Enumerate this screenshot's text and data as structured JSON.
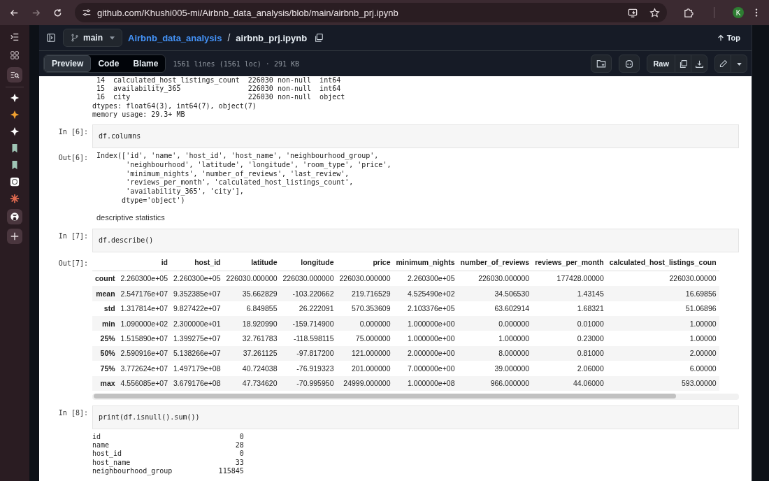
{
  "browser": {
    "url": "github.com/Khushi005-mi/Airbnb_data_analysis/blob/main/airbnb_prj.ipynb",
    "profile_initial": "K"
  },
  "repo": {
    "branch": "main",
    "repo_name": "Airbnb_data_analysis",
    "separator": "/",
    "file_name": "airbnb_prj.ipynb",
    "top_label": "Top"
  },
  "file_toolbar": {
    "views": [
      {
        "label": "Preview",
        "selected": true
      },
      {
        "label": "Code",
        "selected": false
      },
      {
        "label": "Blame",
        "selected": false
      }
    ],
    "info": "1561 lines (1561 loc) · 291 KB",
    "raw_label": "Raw"
  },
  "cells": [
    {
      "kind": "output",
      "lines": [
        " 14  calculated_host_listings_count  226030 non-null  int64",
        " 15  availability_365                226030 non-null  int64",
        " 16  city                            226030 non-null  object",
        "dtypes: float64(3), int64(7), object(7)",
        "memory usage: 29.3+ MB"
      ]
    },
    {
      "kind": "code",
      "prompt": "In [6]:",
      "code": "df.columns"
    },
    {
      "kind": "output",
      "prompt": "Out[6]:",
      "lines": [
        "Index(['id', 'name', 'host_id', 'host_name', 'neighbourhood_group',",
        "       'neighbourhood', 'latitude', 'longitude', 'room_type', 'price',",
        "       'minimum_nights', 'number_of_reviews', 'last_review',",
        "       'reviews_per_month', 'calculated_host_listings_count',",
        "       'availability_365', 'city'],",
        "      dtype='object')"
      ]
    },
    {
      "kind": "markdown",
      "text": "descriptive statistics"
    },
    {
      "kind": "code",
      "prompt": "In [7]:",
      "code": "df.describe()"
    },
    {
      "kind": "dataframe",
      "prompt": "Out[7]:",
      "columns": [
        "id",
        "host_id",
        "latitude",
        "longitude",
        "price",
        "minimum_nights",
        "number_of_reviews",
        "reviews_per_month",
        "calculated_host_listings_coun"
      ],
      "rows": [
        {
          "label": "count",
          "values": [
            "2.260300e+05",
            "2.260300e+05",
            "226030.000000",
            "226030.000000",
            "226030.000000",
            "2.260300e+05",
            "226030.000000",
            "177428.00000",
            "226030.00000"
          ]
        },
        {
          "label": "mean",
          "values": [
            "2.547176e+07",
            "9.352385e+07",
            "35.662829",
            "-103.220662",
            "219.716529",
            "4.525490e+02",
            "34.506530",
            "1.43145",
            "16.69856"
          ]
        },
        {
          "label": "std",
          "values": [
            "1.317814e+07",
            "9.827422e+07",
            "6.849855",
            "26.222091",
            "570.353609",
            "2.103376e+05",
            "63.602914",
            "1.68321",
            "51.06896"
          ]
        },
        {
          "label": "min",
          "values": [
            "1.090000e+02",
            "2.300000e+01",
            "18.920990",
            "-159.714900",
            "0.000000",
            "1.000000e+00",
            "0.000000",
            "0.01000",
            "1.00000"
          ]
        },
        {
          "label": "25%",
          "values": [
            "1.515890e+07",
            "1.399275e+07",
            "32.761783",
            "-118.598115",
            "75.000000",
            "1.000000e+00",
            "1.000000",
            "0.23000",
            "1.00000"
          ]
        },
        {
          "label": "50%",
          "values": [
            "2.590916e+07",
            "5.138266e+07",
            "37.261125",
            "-97.817200",
            "121.000000",
            "2.000000e+00",
            "8.000000",
            "0.81000",
            "2.00000"
          ]
        },
        {
          "label": "75%",
          "values": [
            "3.772624e+07",
            "1.497179e+08",
            "40.724038",
            "-76.919323",
            "201.000000",
            "7.000000e+00",
            "39.000000",
            "2.06000",
            "6.00000"
          ]
        },
        {
          "label": "max",
          "values": [
            "4.556085e+07",
            "3.679176e+08",
            "47.734620",
            "-70.995950",
            "24999.000000",
            "1.000000e+08",
            "966.000000",
            "44.06000",
            "593.00000"
          ]
        }
      ]
    },
    {
      "kind": "code",
      "prompt": "In [8]:",
      "code": "print(df.isnull().sum())"
    },
    {
      "kind": "output",
      "lines": [
        "id                                 0",
        "name                              28",
        "host_id                            0",
        "host_name                         33",
        "neighbourhood_group           115845"
      ]
    }
  ]
}
